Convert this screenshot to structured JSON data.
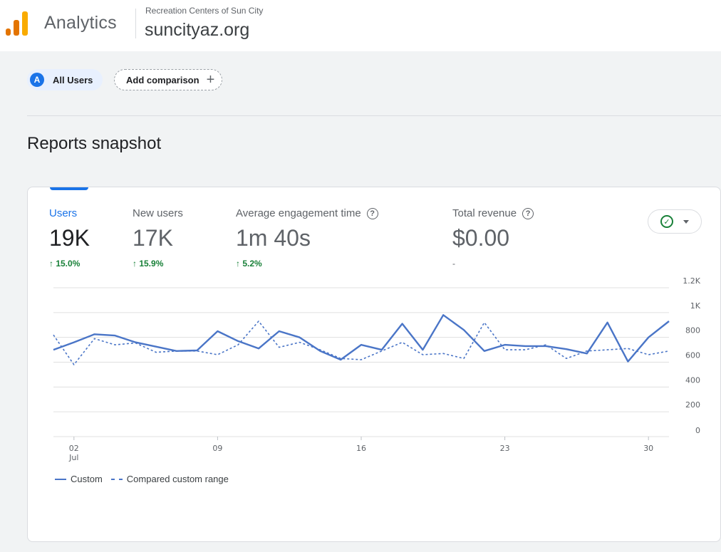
{
  "header": {
    "product_name": "Analytics",
    "account_name": "Recreation Centers of Sun City",
    "property_name": "suncityaz.org",
    "logo_colors": [
      "#f9ab00",
      "#e37400",
      "#e37400"
    ]
  },
  "comparison_bar": {
    "segment_avatar": "A",
    "segment_label": "All Users",
    "add_comparison_label": "Add comparison"
  },
  "page": {
    "title": "Reports snapshot"
  },
  "metrics": [
    {
      "label": "Users",
      "value": "19K",
      "change": "↑ 15.0%",
      "active": true
    },
    {
      "label": "New users",
      "value": "17K",
      "change": "↑ 15.9%",
      "active": false
    },
    {
      "label": "Average engagement time",
      "value": "1m 40s",
      "change": "↑ 5.2%",
      "active": false
    },
    {
      "label": "Total revenue",
      "value": "$0.00",
      "change": "-",
      "active": false
    }
  ],
  "colors": {
    "accent": "#1a73e8",
    "series": "#4a75c7",
    "positive": "#188038"
  },
  "chart_data": {
    "type": "line",
    "x_tick_labels": [
      {
        "index": 1,
        "label": "02",
        "sub": "Jul"
      },
      {
        "index": 8,
        "label": "09",
        "sub": ""
      },
      {
        "index": 15,
        "label": "16",
        "sub": ""
      },
      {
        "index": 22,
        "label": "23",
        "sub": ""
      },
      {
        "index": 29,
        "label": "30",
        "sub": ""
      }
    ],
    "y_ticks": [
      0,
      200,
      400,
      600,
      800,
      1000,
      1200
    ],
    "y_tick_labels": [
      "0",
      "200",
      "400",
      "600",
      "800",
      "1K",
      "1.2K"
    ],
    "ylim": [
      0,
      1200
    ],
    "grid": true,
    "legend_position": "bottom-left",
    "series": [
      {
        "name": "Custom",
        "style": "solid",
        "values": [
          700,
          760,
          825,
          815,
          760,
          725,
          690,
          695,
          850,
          770,
          710,
          850,
          800,
          690,
          620,
          740,
          700,
          910,
          700,
          980,
          860,
          690,
          740,
          730,
          730,
          705,
          670,
          920,
          605,
          800,
          930
        ]
      },
      {
        "name": "Compared custom range",
        "style": "dashed",
        "values": [
          820,
          580,
          790,
          740,
          755,
          680,
          690,
          690,
          660,
          740,
          930,
          720,
          760,
          700,
          630,
          620,
          690,
          760,
          660,
          670,
          630,
          920,
          700,
          700,
          740,
          630,
          690,
          700,
          710,
          660,
          690
        ]
      }
    ]
  }
}
